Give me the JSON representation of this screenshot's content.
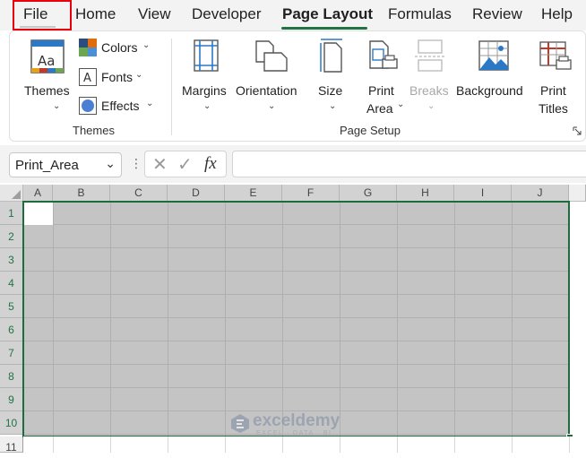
{
  "menu": {
    "tabs": [
      "File",
      "Home",
      "View",
      "Developer",
      "Page Layout",
      "Formulas",
      "Review",
      "Help"
    ],
    "active": "Page Layout"
  },
  "ribbon": {
    "themes_group": {
      "themes_label": "Themes",
      "colors_label": "Colors",
      "fonts_label": "Fonts",
      "effects_label": "Effects",
      "group_label": "Themes"
    },
    "page_setup_group": {
      "margins_label": "Margins",
      "orientation_label": "Orientation",
      "size_label": "Size",
      "print_area_label_1": "Print",
      "print_area_label_2": "Area",
      "breaks_label": "Breaks",
      "background_label": "Background",
      "print_titles_label_1": "Print",
      "print_titles_label_2": "Titles",
      "group_label": "Page Setup"
    }
  },
  "formula_bar": {
    "name_box": "Print_Area",
    "fx_label": "fx",
    "formula": ""
  },
  "sheet": {
    "columns": [
      "A",
      "B",
      "C",
      "D",
      "E",
      "F",
      "G",
      "H",
      "I",
      "J"
    ],
    "rows": [
      "1",
      "2",
      "3",
      "4",
      "5",
      "6",
      "7",
      "8",
      "9",
      "10",
      "11"
    ],
    "selection": "A1:J10"
  },
  "watermark": {
    "name": "exceldemy",
    "tagline": "EXCEL · DATA · BI"
  },
  "colors": {
    "accent": "#217346",
    "selection_fill": "#c4c4c4",
    "highlight": "#e8000b"
  }
}
